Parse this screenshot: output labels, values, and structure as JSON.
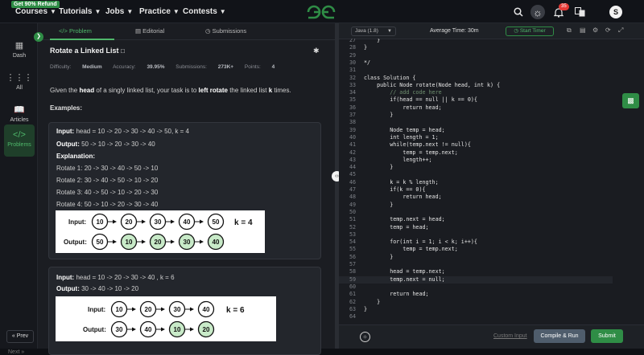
{
  "topbar": {
    "promo": "Get 90% Refund",
    "nav": [
      "Courses",
      "Tutorials",
      "Jobs",
      "Practice",
      "Contests"
    ],
    "notifications_count": "35",
    "avatar_letter": "S"
  },
  "sidebar": {
    "items": [
      "Dash",
      "All",
      "Articles",
      "Problems"
    ],
    "prev": "« Prev",
    "next": "Next »"
  },
  "tabs": [
    "Problem",
    "Editorial",
    "Submissions"
  ],
  "problem": {
    "title": "Rotate a Linked List",
    "difficulty_label": "Difficulty:",
    "difficulty": "Medium",
    "accuracy_label": "Accuracy:",
    "accuracy": "39.95%",
    "submissions_label": "Submissions:",
    "submissions": "273K+",
    "points_label": "Points:",
    "points": "4",
    "desc_pre": "Given the ",
    "desc_b1": "head",
    "desc_mid": " of a singly linked list, your task is to ",
    "desc_b2": "left rotate",
    "desc_mid2": " the linked list ",
    "desc_b3": "k",
    "desc_post": " times.",
    "examples_label": "Examples:"
  },
  "example1": {
    "input_label": "Input:",
    "input": " head = 10 -> 20 -> 30 -> 40 -> 50, k = 4",
    "output_label": "Output:",
    "output": " 50 -> 10 -> 20 -> 30 -> 40",
    "explanation_label": "Explanation:",
    "rotations": [
      "Rotate 1: 20 -> 30 -> 40 -> 50 -> 10",
      "Rotate 2: 30 -> 40 -> 50 -> 10 -> 20",
      "Rotate 3: 40 -> 50 -> 10 -> 20 -> 30",
      "Rotate 4: 50 -> 10 -> 20 -> 30 -> 40"
    ],
    "diagram": {
      "input_label": "Input:",
      "input_nodes": [
        "10",
        "20",
        "30",
        "40",
        "50"
      ],
      "k_label": "k = 4",
      "output_label": "Output:",
      "output_nodes": [
        "50",
        "10",
        "20",
        "30",
        "40"
      ]
    }
  },
  "example2": {
    "input_label": "Input:",
    "input": " head = 10 -> 20 -> 30 -> 40 , k = 6",
    "output_label": "Output:",
    "output": " 30 -> 40 -> 10 -> 20",
    "diagram": {
      "input_label": "Input:",
      "input_nodes": [
        "10",
        "20",
        "30",
        "40"
      ],
      "k_label": "k = 6",
      "output_label": "Output:",
      "output_nodes": [
        "30",
        "40",
        "10",
        "20"
      ]
    }
  },
  "colors": {
    "accent": "#2f8d46",
    "highlight_node": "#c8eac8"
  },
  "editor": {
    "language": "Java (1.8)",
    "avg_time": "Average Time: 30m",
    "timer": "Start Timer",
    "code_lines": [
      {
        "n": "27",
        "t": "    }"
      },
      {
        "n": "28",
        "t": "}"
      },
      {
        "n": "29",
        "t": ""
      },
      {
        "n": "30",
        "t": "*/"
      },
      {
        "n": "31",
        "t": ""
      },
      {
        "n": "32",
        "t": "class Solution {"
      },
      {
        "n": "33",
        "t": "    public Node rotate(Node head, int k) {"
      },
      {
        "n": "34",
        "t": "        // add code here"
      },
      {
        "n": "35",
        "t": "        if(head == null || k == 0){"
      },
      {
        "n": "36",
        "t": "            return head;"
      },
      {
        "n": "37",
        "t": "        }"
      },
      {
        "n": "38",
        "t": ""
      },
      {
        "n": "39",
        "t": "        Node temp = head;"
      },
      {
        "n": "40",
        "t": "        int length = 1;"
      },
      {
        "n": "41",
        "t": "        while(temp.next != null){"
      },
      {
        "n": "42",
        "t": "            temp = temp.next;"
      },
      {
        "n": "43",
        "t": "            length++;"
      },
      {
        "n": "44",
        "t": "        }"
      },
      {
        "n": "45",
        "t": ""
      },
      {
        "n": "46",
        "t": "        k = k % length;"
      },
      {
        "n": "47",
        "t": "        if(k == 0){"
      },
      {
        "n": "48",
        "t": "            return head;"
      },
      {
        "n": "49",
        "t": "        }"
      },
      {
        "n": "50",
        "t": ""
      },
      {
        "n": "51",
        "t": "        temp.next = head;"
      },
      {
        "n": "52",
        "t": "        temp = head;"
      },
      {
        "n": "53",
        "t": ""
      },
      {
        "n": "54",
        "t": "        for(int i = 1; i < k; i++){"
      },
      {
        "n": "55",
        "t": "            temp = temp.next;"
      },
      {
        "n": "56",
        "t": "        }"
      },
      {
        "n": "57",
        "t": ""
      },
      {
        "n": "58",
        "t": "        head = temp.next;"
      },
      {
        "n": "59",
        "t": "        temp.next = null;"
      },
      {
        "n": "60",
        "t": ""
      },
      {
        "n": "61",
        "t": "        return head;"
      },
      {
        "n": "62",
        "t": "    }"
      },
      {
        "n": "63",
        "t": "}"
      },
      {
        "n": "64",
        "t": ""
      }
    ],
    "highlighted_line": "59",
    "custom_input": "Custom Input",
    "compile_run": "Compile & Run",
    "submit": "Submit"
  }
}
